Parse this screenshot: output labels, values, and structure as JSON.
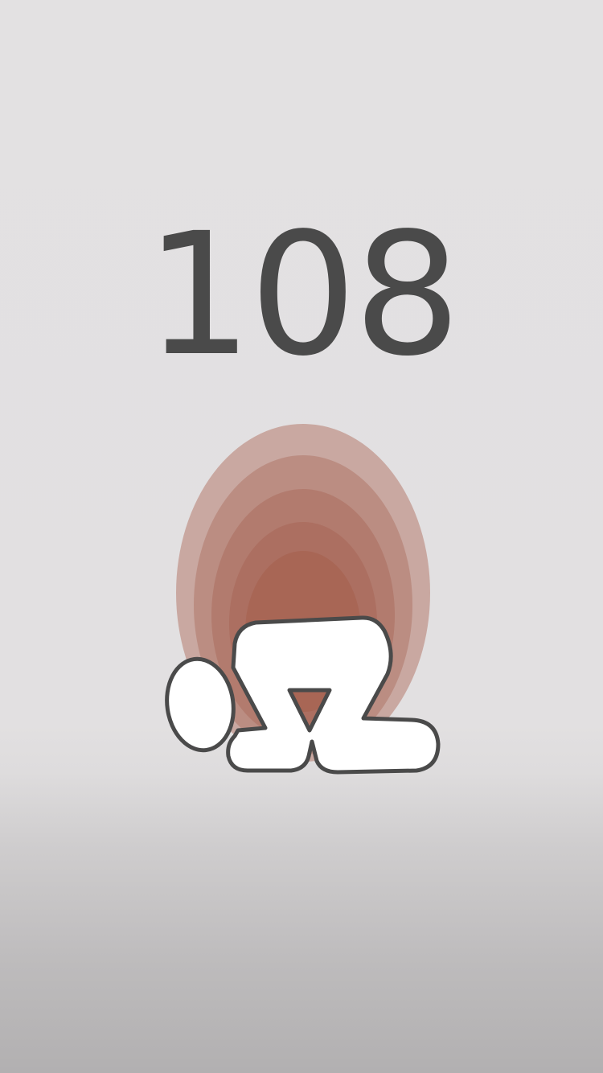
{
  "game": {
    "bow_count": "108"
  },
  "colors": {
    "background_top": "#e3e1e2",
    "background_bottom": "#b2b0b1",
    "counter_text": "#4a4a4a",
    "glow_outer": "#c9a8a1",
    "glow_core": "#a86655",
    "figure_fill": "#ffffff",
    "figure_outline": "#4a4a4a"
  },
  "icons": {
    "glow": "pulse-glow-icon",
    "figure": "kneeling-bow-figure-icon"
  }
}
